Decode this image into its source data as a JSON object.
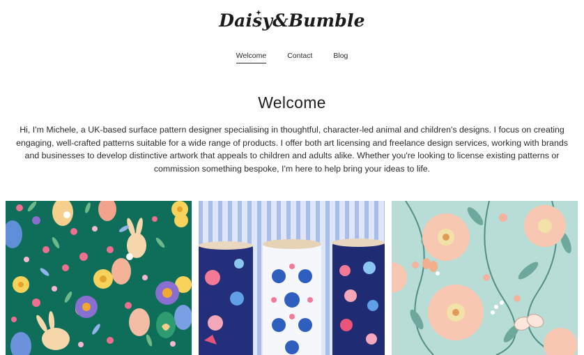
{
  "brand": {
    "logo_text": "Daisy&Bumble"
  },
  "nav": {
    "items": [
      {
        "label": "Welcome",
        "active": true
      },
      {
        "label": "Contact",
        "active": false
      },
      {
        "label": "Blog",
        "active": false
      }
    ]
  },
  "main": {
    "heading": "Welcome",
    "intro": "Hi, I'm Michele, a UK-based surface pattern designer specialising in thoughtful, character-led animal and children's designs. I focus on creating engaging, well-crafted patterns suitable for a wide range of products. I offer both art licensing and freelance design services, working with brands and businesses to develop distinctive artwork that appeals to children and adults alike. Whether you're looking to license existing patterns or commission something bespoke, I'm here to help bring your ideas to life."
  },
  "gallery": {
    "tiles": [
      {
        "subject": "easter-bunny-pattern",
        "background": "#0f6e5a"
      },
      {
        "subject": "fabric-rolls-mockup",
        "background": "#cfd9f4"
      },
      {
        "subject": "peach-floral-pattern",
        "background": "#b8ddd6"
      }
    ]
  },
  "colors": {
    "text": "#1e1e1e",
    "background": "#ffffff"
  }
}
